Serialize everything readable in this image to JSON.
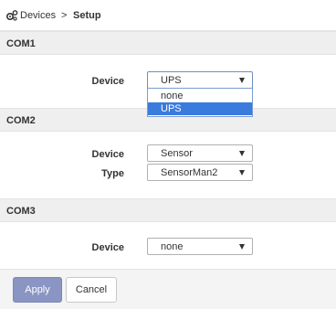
{
  "breadcrumb": {
    "icon": "gears-icon",
    "section": "Devices",
    "separator": ">",
    "page": "Setup"
  },
  "com1": {
    "title": "COM1",
    "device_label": "Device",
    "device_value": "UPS",
    "dropdown_open": true,
    "options": [
      "none",
      "UPS"
    ],
    "highlighted_option": "UPS"
  },
  "com2": {
    "title": "COM2",
    "device_label": "Device",
    "device_value": "Sensor",
    "type_label": "Type",
    "type_value": "SensorMan2"
  },
  "com3": {
    "title": "COM3",
    "device_label": "Device",
    "device_value": "none"
  },
  "footer": {
    "apply_label": "Apply",
    "cancel_label": "Cancel"
  },
  "colors": {
    "highlight": "#3a7bde",
    "apply_button": "#8a95c4",
    "section_header": "#efefef"
  }
}
